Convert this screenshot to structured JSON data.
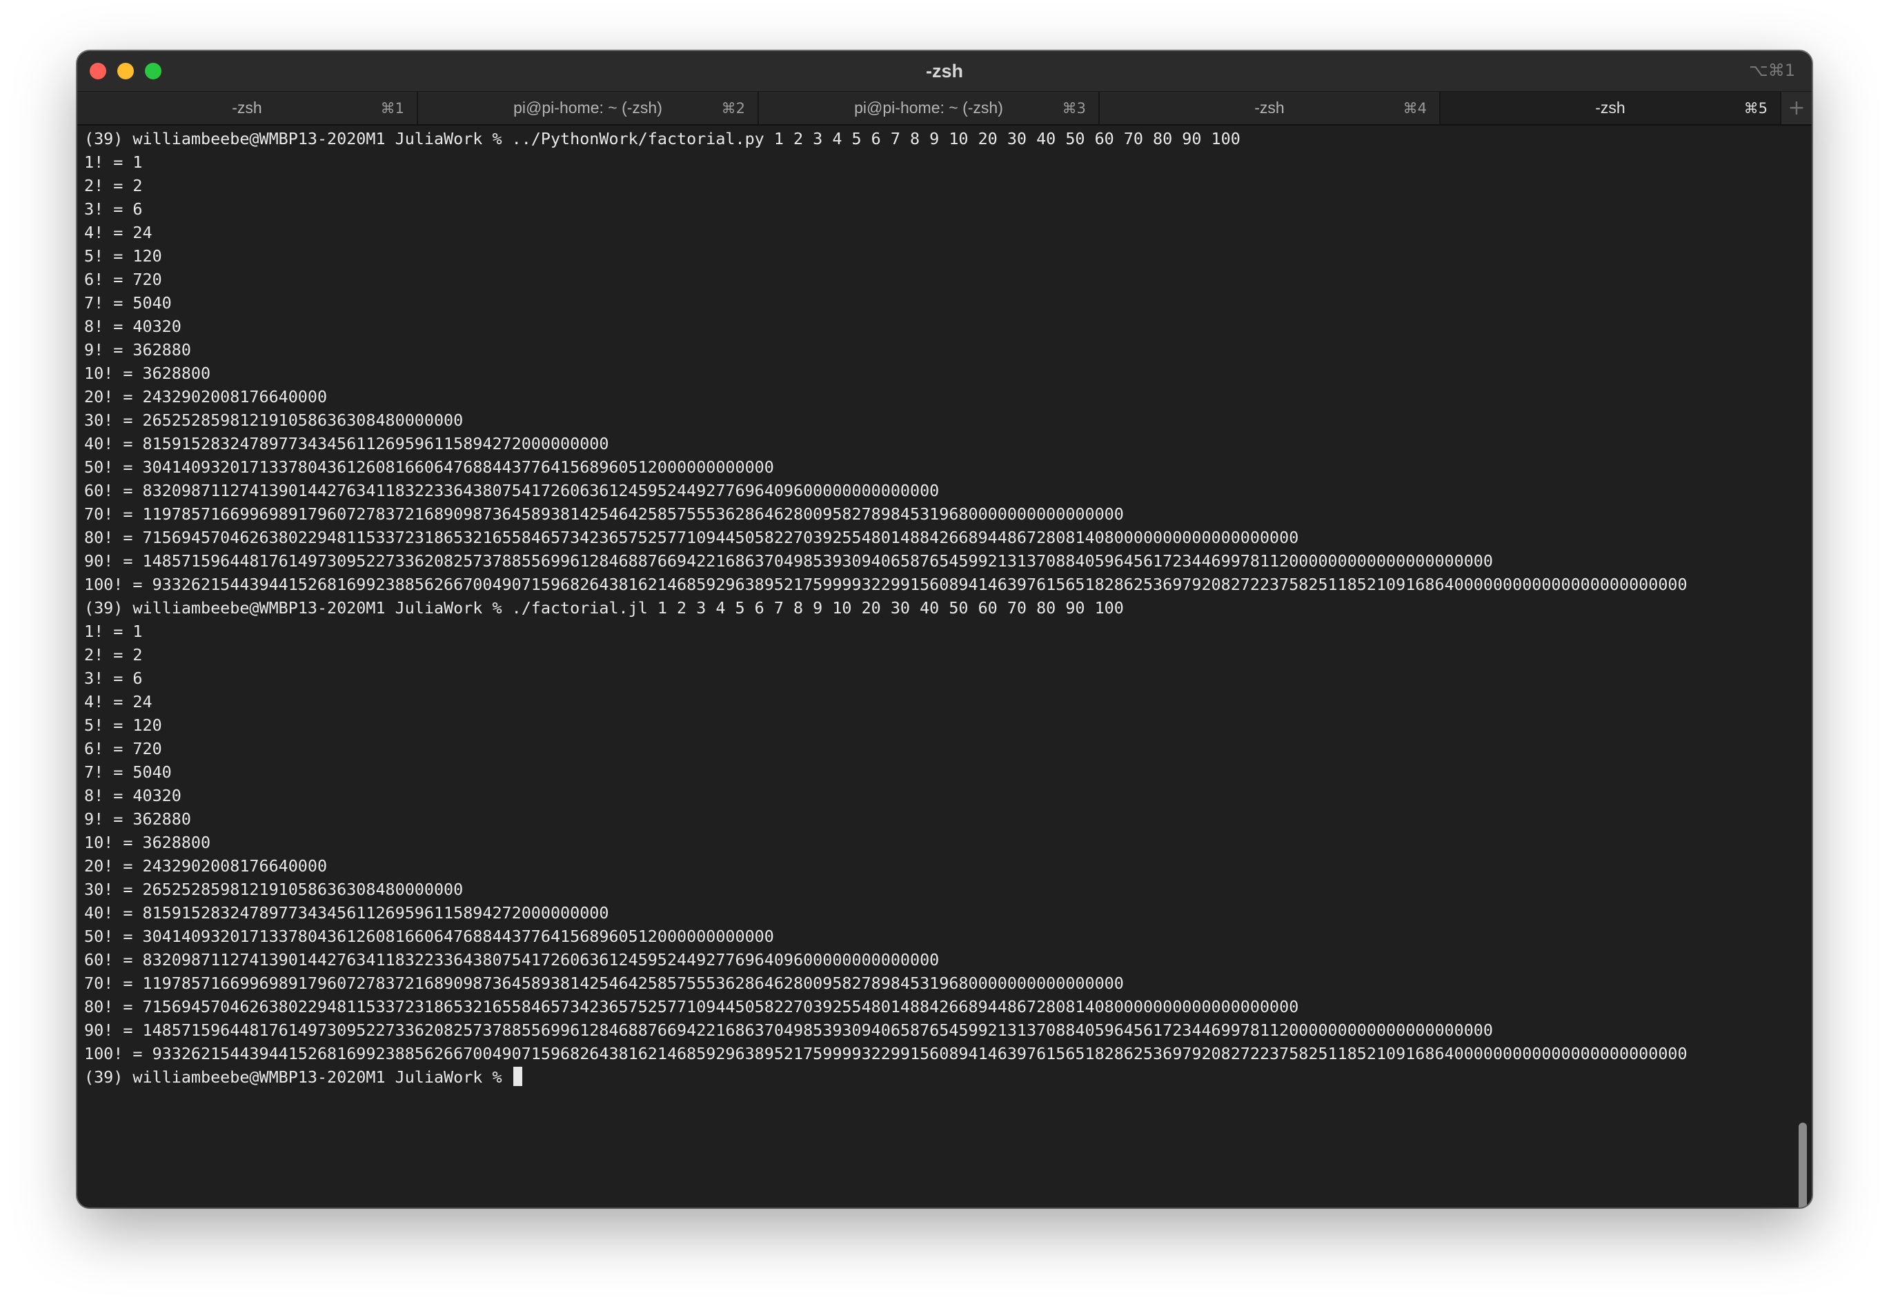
{
  "window": {
    "title": "-zsh",
    "shortcut": "⌥⌘1",
    "traffic_lights": {
      "close": "#ff5f57",
      "minimize": "#febc2e",
      "zoom": "#28c840"
    }
  },
  "tabs": [
    {
      "label": "-zsh",
      "shortcut": "⌘1",
      "active": false
    },
    {
      "label": "pi@pi-home: ~ (-zsh)",
      "shortcut": "⌘2",
      "active": false
    },
    {
      "label": "pi@pi-home: ~ (-zsh)",
      "shortcut": "⌘3",
      "active": false
    },
    {
      "label": "-zsh",
      "shortcut": "⌘4",
      "active": false
    },
    {
      "label": "-zsh",
      "shortcut": "⌘5",
      "active": true
    }
  ],
  "new_tab_label": "+",
  "terminal": {
    "lines": [
      "(39) williambeebe@WMBP13-2020M1 JuliaWork % ../PythonWork/factorial.py 1 2 3 4 5 6 7 8 9 10 20 30 40 50 60 70 80 90 100",
      "1! = 1",
      "2! = 2",
      "3! = 6",
      "4! = 24",
      "5! = 120",
      "6! = 720",
      "7! = 5040",
      "8! = 40320",
      "9! = 362880",
      "10! = 3628800",
      "20! = 2432902008176640000",
      "30! = 265252859812191058636308480000000",
      "40! = 815915283247897734345611269596115894272000000000",
      "50! = 30414093201713378043612608166064768844377641568960512000000000000",
      "60! = 8320987112741390144276341183223364380754172606361245952449277696409600000000000000",
      "70! = 11978571669969891796072783721689098736458938142546425857555362864628009582789845319680000000000000000",
      "80! = 71569457046263802294811533723186532165584657342365752577109445058227039255480148842668944867280814080000000000000000000",
      "90! = 1485715964481761497309522733620825737885569961284688766942216863704985393094065876545992131370884059645617234469978112000000000000000000000",
      "100! = 93326215443944152681699238856266700490715968264381621468592963895217599993229915608941463976156518286253697920827223758251185210916864000000000000000000000000",
      "(39) williambeebe@WMBP13-2020M1 JuliaWork % ./factorial.jl 1 2 3 4 5 6 7 8 9 10 20 30 40 50 60 70 80 90 100",
      "1! = 1",
      "2! = 2",
      "3! = 6",
      "4! = 24",
      "5! = 120",
      "6! = 720",
      "7! = 5040",
      "8! = 40320",
      "9! = 362880",
      "10! = 3628800",
      "20! = 2432902008176640000",
      "30! = 265252859812191058636308480000000",
      "40! = 815915283247897734345611269596115894272000000000",
      "50! = 30414093201713378043612608166064768844377641568960512000000000000",
      "60! = 8320987112741390144276341183223364380754172606361245952449277696409600000000000000",
      "70! = 11978571669969891796072783721689098736458938142546425857555362864628009582789845319680000000000000000",
      "80! = 71569457046263802294811533723186532165584657342365752577109445058227039255480148842668944867280814080000000000000000000",
      "90! = 1485715964481761497309522733620825737885569961284688766942216863704985393094065876545992131370884059645617234469978112000000000000000000000",
      "100! = 93326215443944152681699238856266700490715968264381621468592963895217599993229915608941463976156518286253697920827223758251185210916864000000000000000000000000"
    ],
    "prompt": "(39) williambeebe@WMBP13-2020M1 JuliaWork % "
  },
  "colors": {
    "background": "#1f1f1f",
    "foreground": "#e8e8e8",
    "chrome": "#2b2b2b"
  }
}
